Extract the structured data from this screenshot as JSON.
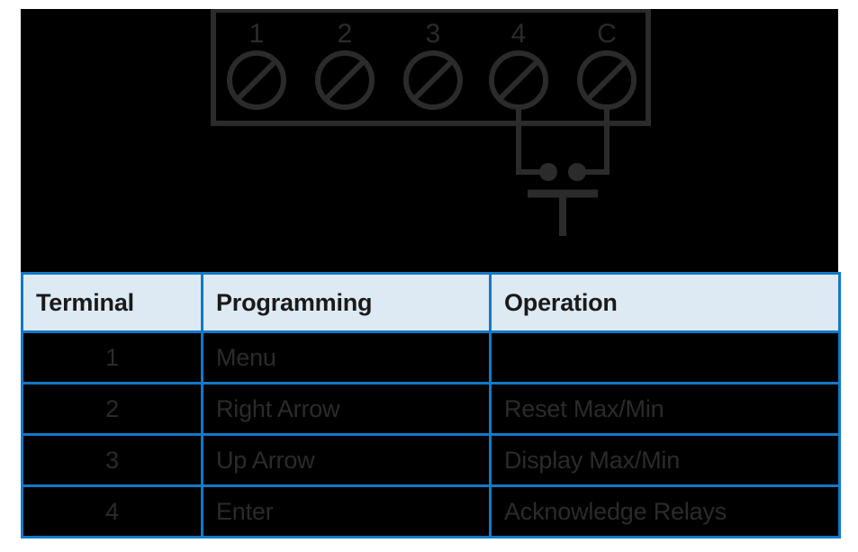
{
  "diagram": {
    "name": "terminal-block-pushbutton-wiring-diagram",
    "background_color": "#000000",
    "line_color": "#2b2b2b",
    "terminal_labels": [
      "1",
      "2",
      "3",
      "4",
      "C"
    ],
    "wired_terminals": [
      "4",
      "C"
    ],
    "switch_symbol": "normally-open-pushbutton"
  },
  "table": {
    "border_color": "#1279c6",
    "header_background": "#dde9f3",
    "header_text_color": "#1a1a1a",
    "body_background": "#000000",
    "body_text_color": "#2b2b2b",
    "columns": [
      "Terminal",
      "Programming",
      "Operation"
    ],
    "rows": [
      {
        "terminal": "1",
        "programming": "Menu",
        "operation": ""
      },
      {
        "terminal": "2",
        "programming": "Right Arrow",
        "operation": "Reset Max/Min"
      },
      {
        "terminal": "3",
        "programming": "Up Arrow",
        "operation": "Display Max/Min"
      },
      {
        "terminal": "4",
        "programming": "Enter",
        "operation": "Acknowledge Relays"
      }
    ]
  }
}
